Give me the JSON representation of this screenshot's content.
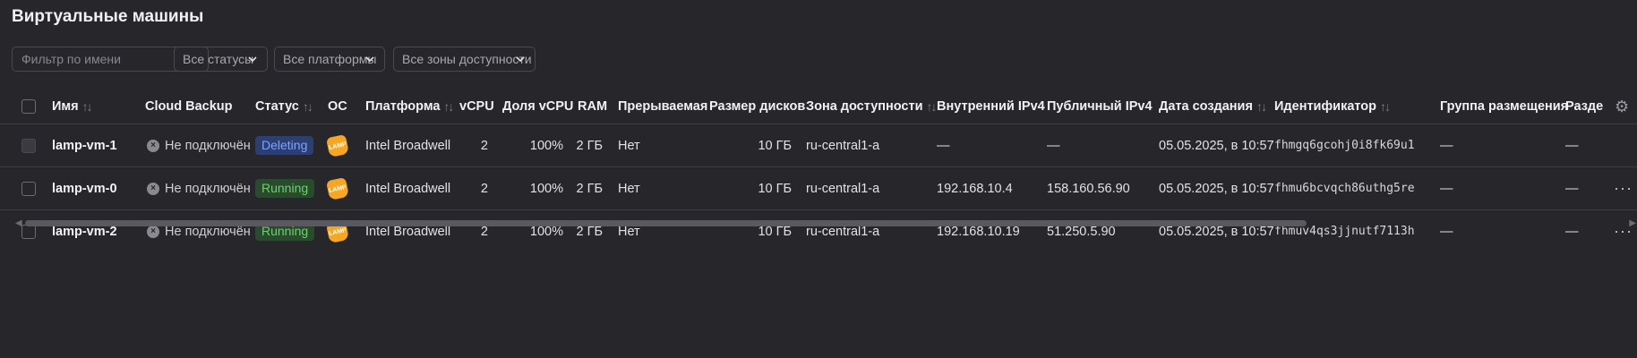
{
  "page": {
    "title": "Виртуальные машины"
  },
  "filters": {
    "name_placeholder": "Фильтр по имени",
    "status": "Все статусы",
    "platform": "Все платформы",
    "zone": "Все зоны доступности"
  },
  "table": {
    "columns": {
      "name": "Имя",
      "backup": "Cloud Backup",
      "status": "Статус",
      "os": "ОС",
      "platform": "Платформа",
      "vcpu": "vCPU",
      "vcpu_share": "Доля vCPU",
      "ram": "RAM",
      "preemptible": "Прерываемая",
      "disk_size": "Размер дисков",
      "zone": "Зона доступности",
      "internal_ip": "Внутренний IPv4",
      "public_ip": "Публичный IPv4",
      "created": "Дата создания",
      "id": "Идентификатор",
      "placement": "Группа размещения",
      "shared": "Раздел"
    },
    "rows": [
      {
        "name": "lamp-vm-1",
        "backup": "Не подключён",
        "status": "Deleting",
        "os": "LAMP",
        "platform": "Intel Broadwell",
        "vcpu": "2",
        "vcpu_share": "100%",
        "ram": "2 ГБ",
        "preemptible": "Нет",
        "disk_size": "10 ГБ",
        "zone": "ru-central1-a",
        "internal_ip": "—",
        "public_ip": "—",
        "created": "05.05.2025, в 10:57",
        "id": "fhmgq6gcohj0i8fk69u1",
        "placement": "—",
        "shared": "—"
      },
      {
        "name": "lamp-vm-0",
        "backup": "Не подключён",
        "status": "Running",
        "os": "LAMP",
        "platform": "Intel Broadwell",
        "vcpu": "2",
        "vcpu_share": "100%",
        "ram": "2 ГБ",
        "preemptible": "Нет",
        "disk_size": "10 ГБ",
        "zone": "ru-central1-a",
        "internal_ip": "192.168.10.4",
        "public_ip": "158.160.56.90",
        "created": "05.05.2025, в 10:57",
        "id": "fhmu6bcvqch86uthg5re",
        "placement": "—",
        "shared": "—"
      },
      {
        "name": "lamp-vm-2",
        "backup": "Не подключён",
        "status": "Running",
        "os": "LAMP",
        "platform": "Intel Broadwell",
        "vcpu": "2",
        "vcpu_share": "100%",
        "ram": "2 ГБ",
        "preemptible": "Нет",
        "disk_size": "10 ГБ",
        "zone": "ru-central1-a",
        "internal_ip": "192.168.10.19",
        "public_ip": "51.250.5.90",
        "created": "05.05.2025, в 10:57",
        "id": "fhmuv4qs3jjnutf7113h",
        "placement": "—",
        "shared": "—"
      }
    ]
  },
  "icons": {
    "sort": "sort-arrows-icon",
    "settings": "gear-icon",
    "backup_off": "x-circle-icon",
    "row_menu": "more-dots-icon",
    "chevron": "chevron-down-icon"
  },
  "colors": {
    "background": "#27262b",
    "deleting_bg": "#2c3f73",
    "deleting_text": "#7fa3ff",
    "running_bg": "#2a4a2e",
    "running_text": "#6fcf6f",
    "os_icon": "#f5a623"
  }
}
